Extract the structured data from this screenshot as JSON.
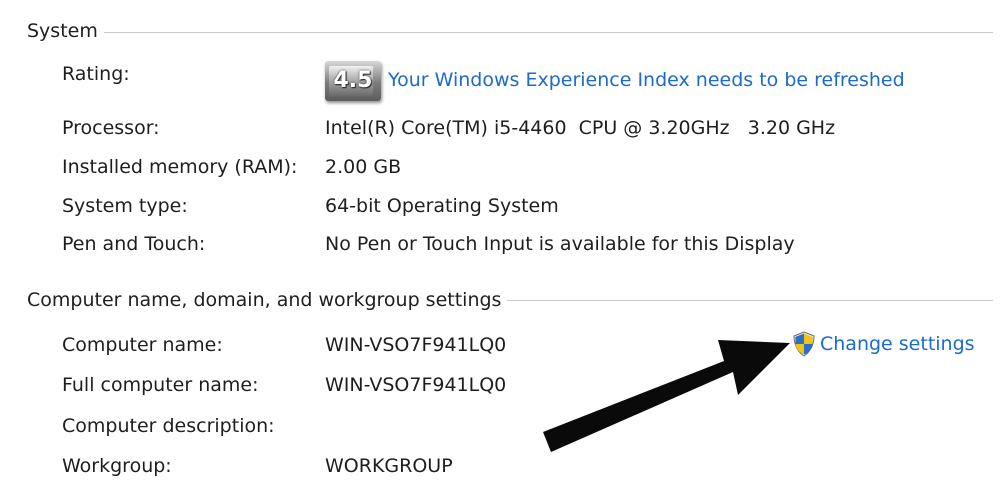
{
  "sections": {
    "system": {
      "title": "System",
      "rating_label": "Rating:",
      "rating_value": "4.5",
      "rating_link": "Your Windows Experience Index needs to be refreshed",
      "rows": [
        {
          "label": "Processor:",
          "value": "Intel(R) Core(TM) i5-4460  CPU @ 3.20GHz   3.20 GHz"
        },
        {
          "label": "Installed memory (RAM):",
          "value": "2.00 GB"
        },
        {
          "label": "System type:",
          "value": "64-bit Operating System"
        },
        {
          "label": "Pen and Touch:",
          "value": "No Pen or Touch Input is available for this Display"
        }
      ]
    },
    "computer": {
      "title": "Computer name, domain, and workgroup settings",
      "change_settings_label": "Change settings",
      "rows": [
        {
          "label": "Computer name:",
          "value": "WIN-VSO7F941LQ0"
        },
        {
          "label": "Full computer name:",
          "value": "WIN-VSO7F941LQ0"
        },
        {
          "label": "Computer description:",
          "value": ""
        },
        {
          "label": "Workgroup:",
          "value": "WORKGROUP"
        }
      ]
    }
  },
  "icons": {
    "rating": "windows-experience-index-badge-icon",
    "change_settings": "uac-shield-icon",
    "annotation": "black-arrow-icon"
  },
  "colors": {
    "link": "#1c6bc9",
    "text": "#1e1e1e",
    "rule": "#c9c9c9"
  }
}
